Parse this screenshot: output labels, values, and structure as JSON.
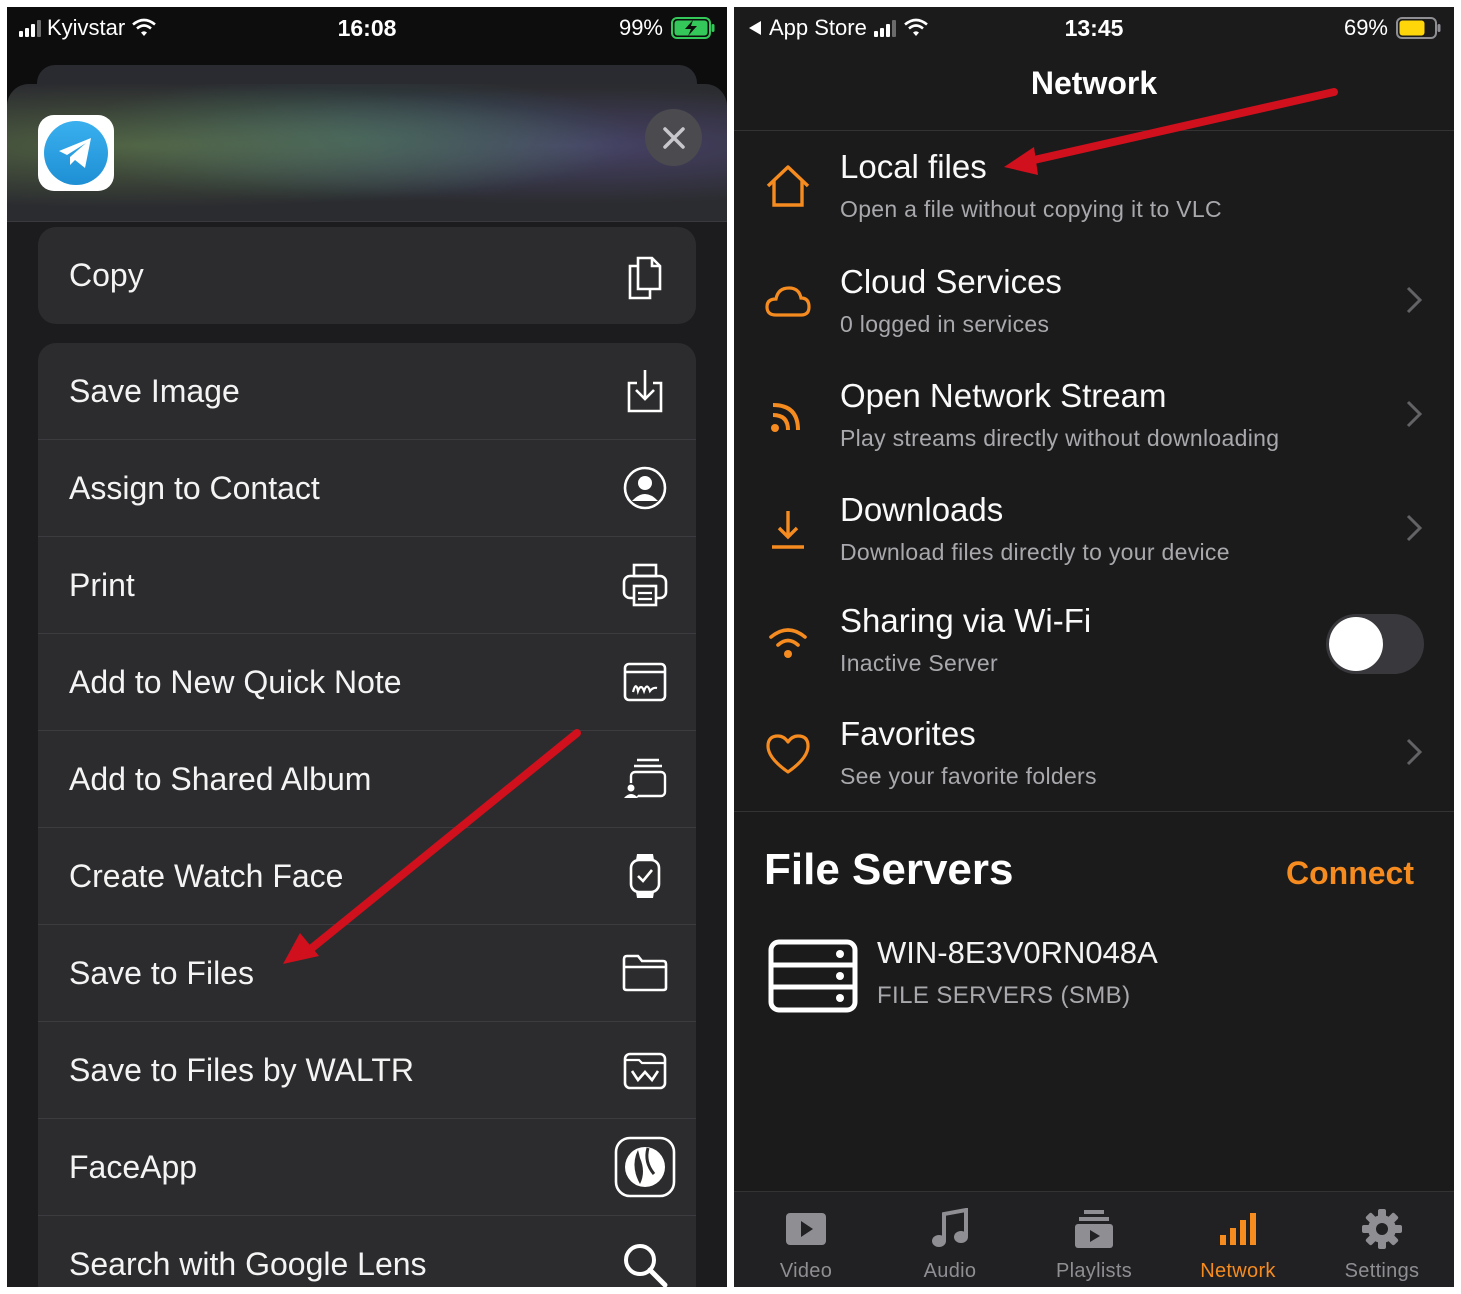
{
  "left_phone": {
    "status_bar": {
      "carrier": "Kyivstar",
      "time": "16:08",
      "battery": "99%"
    },
    "app_icon": "telegram-icon",
    "close_icon": "close-icon",
    "actions_group1": [
      {
        "label": "Copy",
        "icon": "copy-icon"
      }
    ],
    "actions_group2": [
      {
        "label": "Save Image",
        "icon": "save-image-icon"
      },
      {
        "label": "Assign to Contact",
        "icon": "contact-icon"
      },
      {
        "label": "Print",
        "icon": "printer-icon"
      },
      {
        "label": "Add to New Quick Note",
        "icon": "quick-note-icon"
      },
      {
        "label": "Add to Shared Album",
        "icon": "shared-album-icon"
      },
      {
        "label": "Create Watch Face",
        "icon": "watch-icon"
      },
      {
        "label": "Save to Files",
        "icon": "folder-icon"
      },
      {
        "label": "Save to Files by WALTR",
        "icon": "waltr-folder-icon"
      },
      {
        "label": "FaceApp",
        "icon": "faceapp-icon"
      },
      {
        "label": "Search with Google Lens",
        "icon": "search-icon"
      }
    ],
    "accent_arrow_color": "#d0101c"
  },
  "right_phone": {
    "status_bar": {
      "back_app": "App Store",
      "time": "13:45",
      "battery": "69%"
    },
    "nav_title": "Network",
    "rows": [
      {
        "title": "Local files",
        "subtitle": "Open a file without copying it to VLC",
        "icon": "home-icon"
      },
      {
        "title": "Cloud Services",
        "subtitle": "0 logged in services",
        "icon": "cloud-icon"
      },
      {
        "title": "Open Network Stream",
        "subtitle": "Play streams directly without downloading",
        "icon": "rss-icon"
      },
      {
        "title": "Downloads",
        "subtitle": "Download files directly to your device",
        "icon": "download-icon"
      },
      {
        "title": "Sharing via Wi-Fi",
        "subtitle": "Inactive Server",
        "icon": "wifi-icon",
        "toggle_on": false
      },
      {
        "title": "Favorites",
        "subtitle": "See your favorite folders",
        "icon": "heart-icon"
      }
    ],
    "file_servers": {
      "title": "File Servers",
      "connect_label": "Connect",
      "server_name": "WIN-8E3V0RN048A",
      "server_type": "FILE SERVERS (SMB)"
    },
    "tabs": [
      {
        "label": "Video",
        "icon": "video-icon",
        "active": false
      },
      {
        "label": "Audio",
        "icon": "music-note-icon",
        "active": false
      },
      {
        "label": "Playlists",
        "icon": "playlists-icon",
        "active": false
      },
      {
        "label": "Network",
        "icon": "network-bars-icon",
        "active": true
      },
      {
        "label": "Settings",
        "icon": "gear-icon",
        "active": false
      }
    ],
    "accent_color": "#f68b1f"
  }
}
